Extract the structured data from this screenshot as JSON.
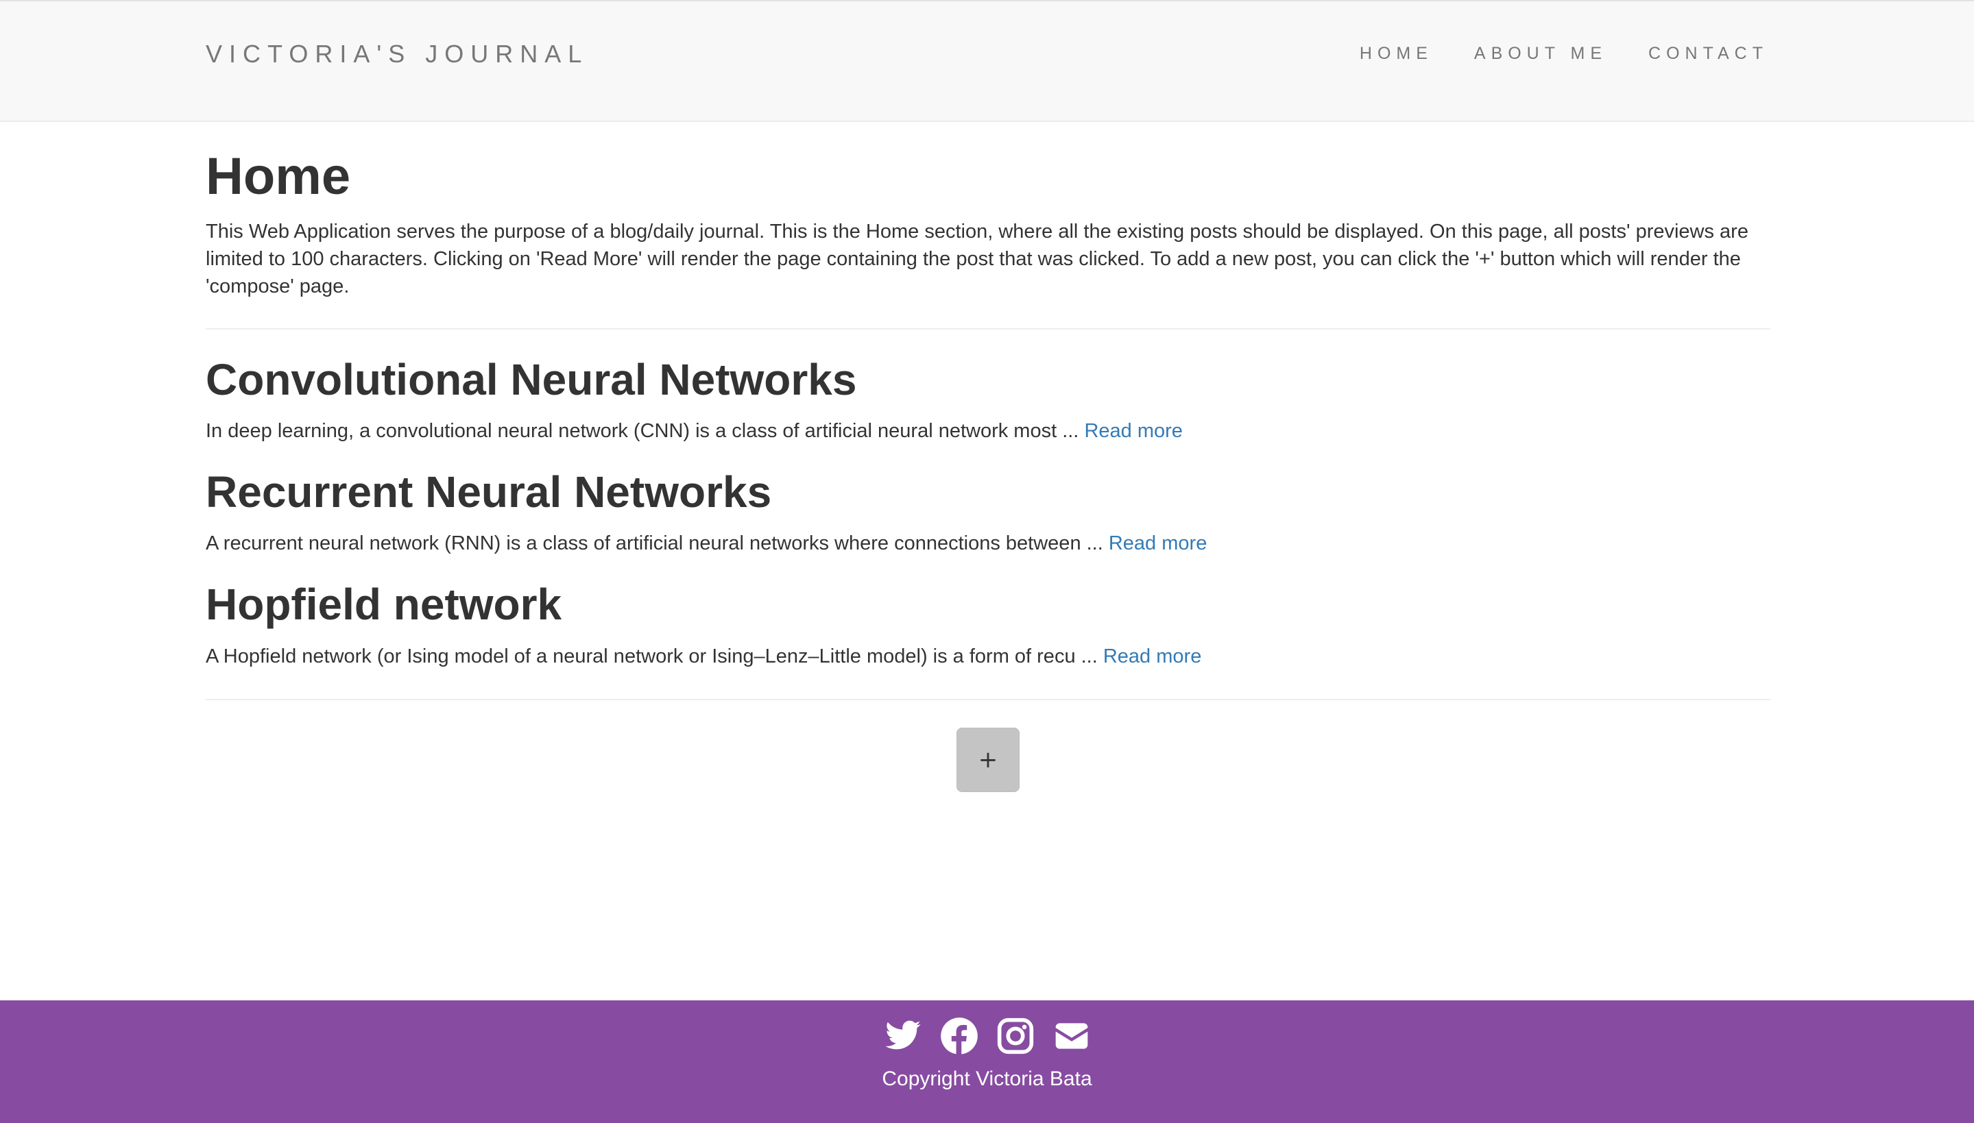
{
  "navbar": {
    "brand": "VICTORIA'S JOURNAL",
    "links": [
      "HOME",
      "ABOUT ME",
      "CONTACT"
    ]
  },
  "main": {
    "title": "Home",
    "intro": "This Web Application serves the purpose of a blog/daily journal. This is the Home section, where all the existing posts should be displayed. On this page, all posts' previews are limited to 100 characters. Clicking on 'Read More' will render the page containing the post that was clicked. To add a new post, you can click the '+' button which will render the 'compose' page.",
    "posts": [
      {
        "title": "Convolutional Neural Networks",
        "preview": "In deep learning, a convolutional neural network (CNN) is a class of artificial neural network most ... ",
        "read_more": "Read more"
      },
      {
        "title": "Recurrent Neural Networks",
        "preview": "A recurrent neural network (RNN) is a class of artificial neural networks where connections between ... ",
        "read_more": "Read more"
      },
      {
        "title": "Hopfield network",
        "preview": "A Hopfield network (or Ising model of a neural network or Ising–Lenz–Little model) is a form of recu ... ",
        "read_more": "Read more"
      }
    ],
    "add_button": "+"
  },
  "footer": {
    "icons": [
      "twitter-icon",
      "facebook-icon",
      "instagram-icon",
      "envelope-icon"
    ],
    "copyright": "Copyright Victoria Bata"
  },
  "colors": {
    "navbar_bg": "#f8f8f8",
    "footer_bg": "#874ca1",
    "link": "#337ab7",
    "text": "#333333"
  }
}
